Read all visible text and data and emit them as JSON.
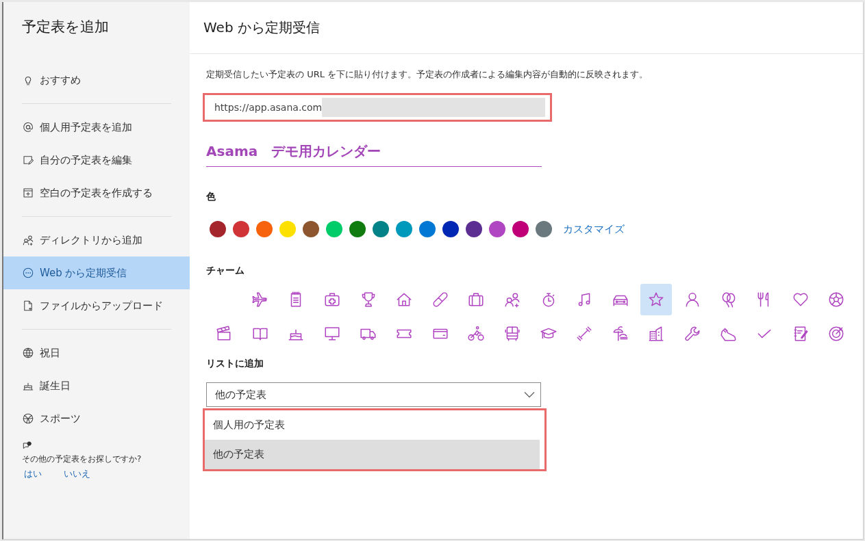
{
  "sidebar": {
    "title": "予定表を追加",
    "groups": [
      [
        {
          "kind": "bulb",
          "label": "おすすめ",
          "selected": false
        }
      ],
      [
        {
          "kind": "at",
          "label": "個人用予定表を追加",
          "selected": false
        },
        {
          "kind": "edit",
          "label": "自分の予定表を編集",
          "selected": false
        },
        {
          "kind": "calendar-plus",
          "label": "空白の予定表を作成する",
          "selected": false
        }
      ],
      [
        {
          "kind": "people",
          "label": "ディレクトリから追加",
          "selected": false
        },
        {
          "kind": "dots",
          "label": "Web から定期受信",
          "selected": true
        },
        {
          "kind": "file",
          "label": "ファイルからアップロード",
          "selected": false
        }
      ],
      [
        {
          "kind": "globe",
          "label": "祝日",
          "selected": false
        },
        {
          "kind": "cake",
          "label": "誕生日",
          "selected": false
        },
        {
          "kind": "ball",
          "label": "スポーツ",
          "selected": false
        }
      ]
    ],
    "prompt": {
      "text": "その他の予定表をお探しですか?",
      "links": [
        "はい",
        "いいえ"
      ]
    }
  },
  "main": {
    "title": "Web から定期受信",
    "description": "定期受信したい予定表の URL を下に貼り付けます。予定表の作成者による編集内容が自動的に反映されます。",
    "url": {
      "value": "https://app.asana.com",
      "redacted": true,
      "highlighted": true
    },
    "calendar_name": "Asama　デモ用カレンダー",
    "color_label": "色",
    "colors": [
      {
        "color": "#a4262c"
      },
      {
        "color": "#d13438"
      },
      {
        "color": "#f7630c"
      },
      {
        "color": "#fce100"
      },
      {
        "color": "#8e562e"
      },
      {
        "color": "#00cc6a"
      },
      {
        "color": "#107c10"
      },
      {
        "color": "#038387"
      },
      {
        "color": "#0099bc"
      },
      {
        "color": "#0078d4"
      },
      {
        "color": "#0027b4"
      },
      {
        "color": "#5c2e91"
      },
      {
        "color": "#b146c2"
      },
      {
        "color": "#bf0077"
      },
      {
        "color": "#69797e"
      }
    ],
    "customize_link": "カスタマイズ",
    "charm_label": "チャーム",
    "charms": [
      {
        "kind": "plane",
        "selected": false
      },
      {
        "kind": "notepad",
        "selected": false
      },
      {
        "kind": "firstaid",
        "selected": false
      },
      {
        "kind": "trophy",
        "selected": false
      },
      {
        "kind": "home",
        "selected": false
      },
      {
        "kind": "pill",
        "selected": false
      },
      {
        "kind": "briefcase",
        "selected": false
      },
      {
        "kind": "people",
        "selected": false
      },
      {
        "kind": "stopwatch",
        "selected": false
      },
      {
        "kind": "music",
        "selected": false
      },
      {
        "kind": "car",
        "selected": false
      },
      {
        "kind": "star",
        "selected": true
      },
      {
        "kind": "person",
        "selected": false
      },
      {
        "kind": "balloons",
        "selected": false
      },
      {
        "kind": "cutlery",
        "selected": false
      },
      {
        "kind": "heart",
        "selected": false
      },
      {
        "kind": "soccer",
        "selected": false
      },
      {
        "kind": "clapper",
        "selected": false
      },
      {
        "kind": "book",
        "selected": false
      },
      {
        "kind": "cake",
        "selected": false
      },
      {
        "kind": "monitor",
        "selected": false
      },
      {
        "kind": "truck",
        "selected": false
      },
      {
        "kind": "ticket",
        "selected": false
      },
      {
        "kind": "card",
        "selected": false
      },
      {
        "kind": "bike",
        "selected": false
      },
      {
        "kind": "bus",
        "selected": false
      },
      {
        "kind": "gradcap",
        "selected": false
      },
      {
        "kind": "dumbbell",
        "selected": false
      },
      {
        "kind": "beach",
        "selected": false
      },
      {
        "kind": "building",
        "selected": false
      },
      {
        "kind": "wrench",
        "selected": false
      },
      {
        "kind": "shoe",
        "selected": false
      },
      {
        "kind": "check",
        "selected": false
      },
      {
        "kind": "notes",
        "selected": false
      },
      {
        "kind": "target",
        "selected": false
      }
    ],
    "list_label": "リストに追加",
    "dropdown": {
      "value": "他の予定表",
      "expanded": true,
      "highlighted": true,
      "options": [
        {
          "label": "個人用の予定表",
          "selected": false
        },
        {
          "label": "他の予定表",
          "selected": true
        }
      ]
    }
  }
}
